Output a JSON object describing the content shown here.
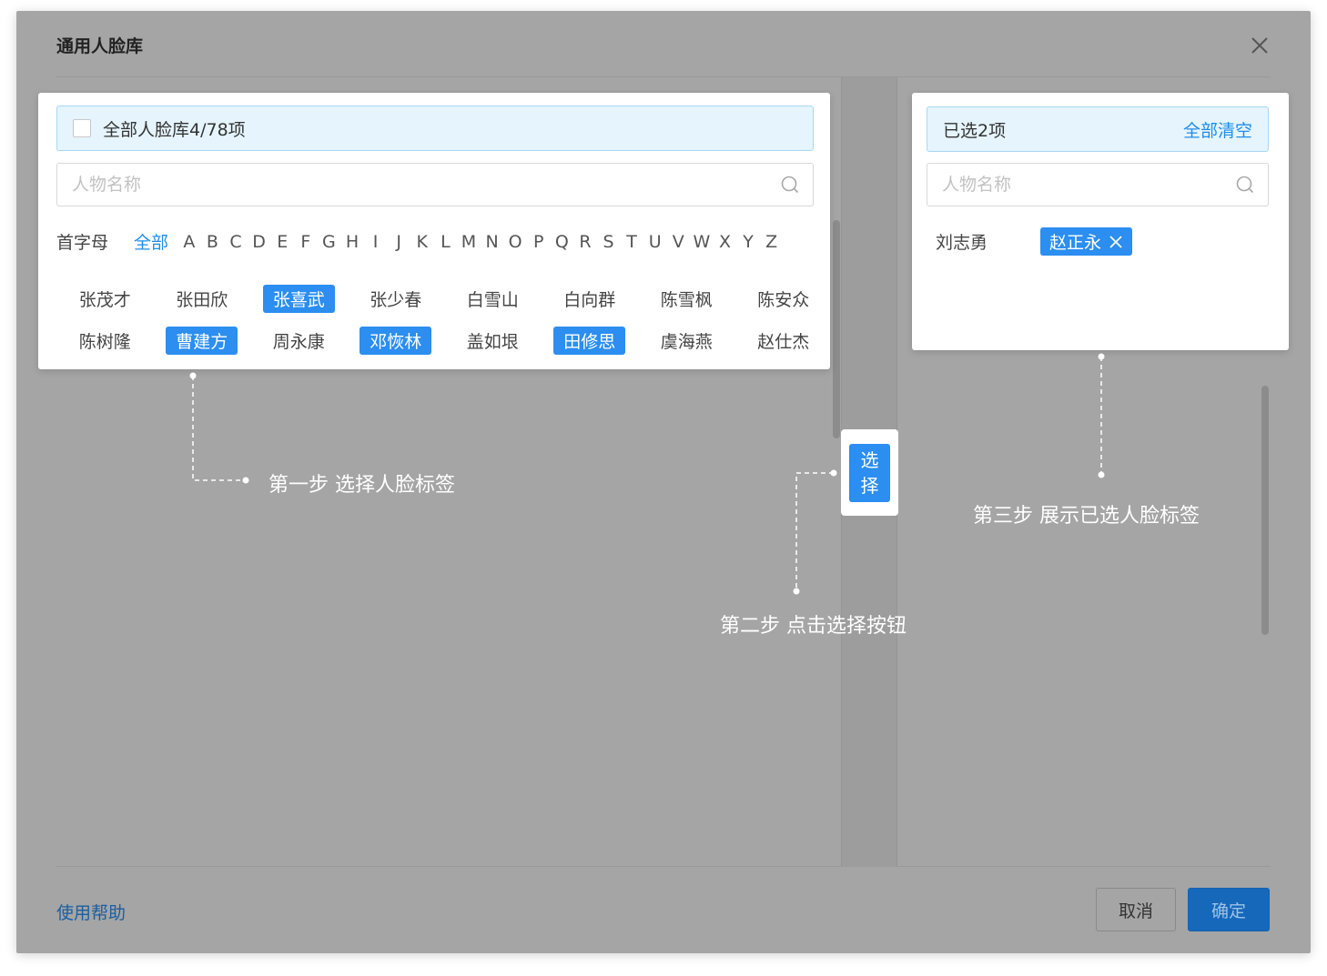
{
  "dialog": {
    "title": "通用人脸库"
  },
  "left_panel": {
    "header": "全部人脸库4/78项",
    "search_placeholder": "人物名称",
    "alpha_label": "首字母",
    "alpha_all": "全部",
    "letters": [
      "A",
      "B",
      "C",
      "D",
      "E",
      "F",
      "G",
      "H",
      "I",
      "J",
      "K",
      "L",
      "M",
      "N",
      "O",
      "P",
      "Q",
      "R",
      "S",
      "T",
      "U",
      "V",
      "W",
      "X",
      "Y",
      "Z"
    ],
    "names": [
      {
        "name": "张茂才",
        "selected": false
      },
      {
        "name": "张田欣",
        "selected": false
      },
      {
        "name": "张喜武",
        "selected": true
      },
      {
        "name": "张少春",
        "selected": false
      },
      {
        "name": "白雪山",
        "selected": false
      },
      {
        "name": "白向群",
        "selected": false
      },
      {
        "name": "陈雪枫",
        "selected": false
      },
      {
        "name": "陈安众",
        "selected": false
      },
      {
        "name": "陈树隆",
        "selected": false
      },
      {
        "name": "曹建方",
        "selected": true
      },
      {
        "name": "周永康",
        "selected": false
      },
      {
        "name": "邓恢林",
        "selected": true
      },
      {
        "name": "盖如垠",
        "selected": false
      },
      {
        "name": "田修思",
        "selected": true
      },
      {
        "name": "虞海燕",
        "selected": false
      },
      {
        "name": "赵仕杰",
        "selected": false
      }
    ]
  },
  "select_button": {
    "line1": "选",
    "line2": "择"
  },
  "right_panel": {
    "header": "已选2项",
    "clear_all": "全部清空",
    "search_placeholder": "人物名称",
    "chosen_plain": "刘志勇",
    "chosen_tag": "赵正永"
  },
  "annotations": {
    "step1": "第一步  选择人脸标签",
    "step2": "第二步  点击选择按钮",
    "step3": "第三步  展示已选人脸标签"
  },
  "footer": {
    "help": "使用帮助",
    "cancel": "取消",
    "ok": "确定"
  },
  "colors": {
    "accent": "#2b8ef0",
    "link": "#1f8ee9",
    "overlay": "#a5a5a5",
    "header_bg": "#e5f4fd"
  }
}
